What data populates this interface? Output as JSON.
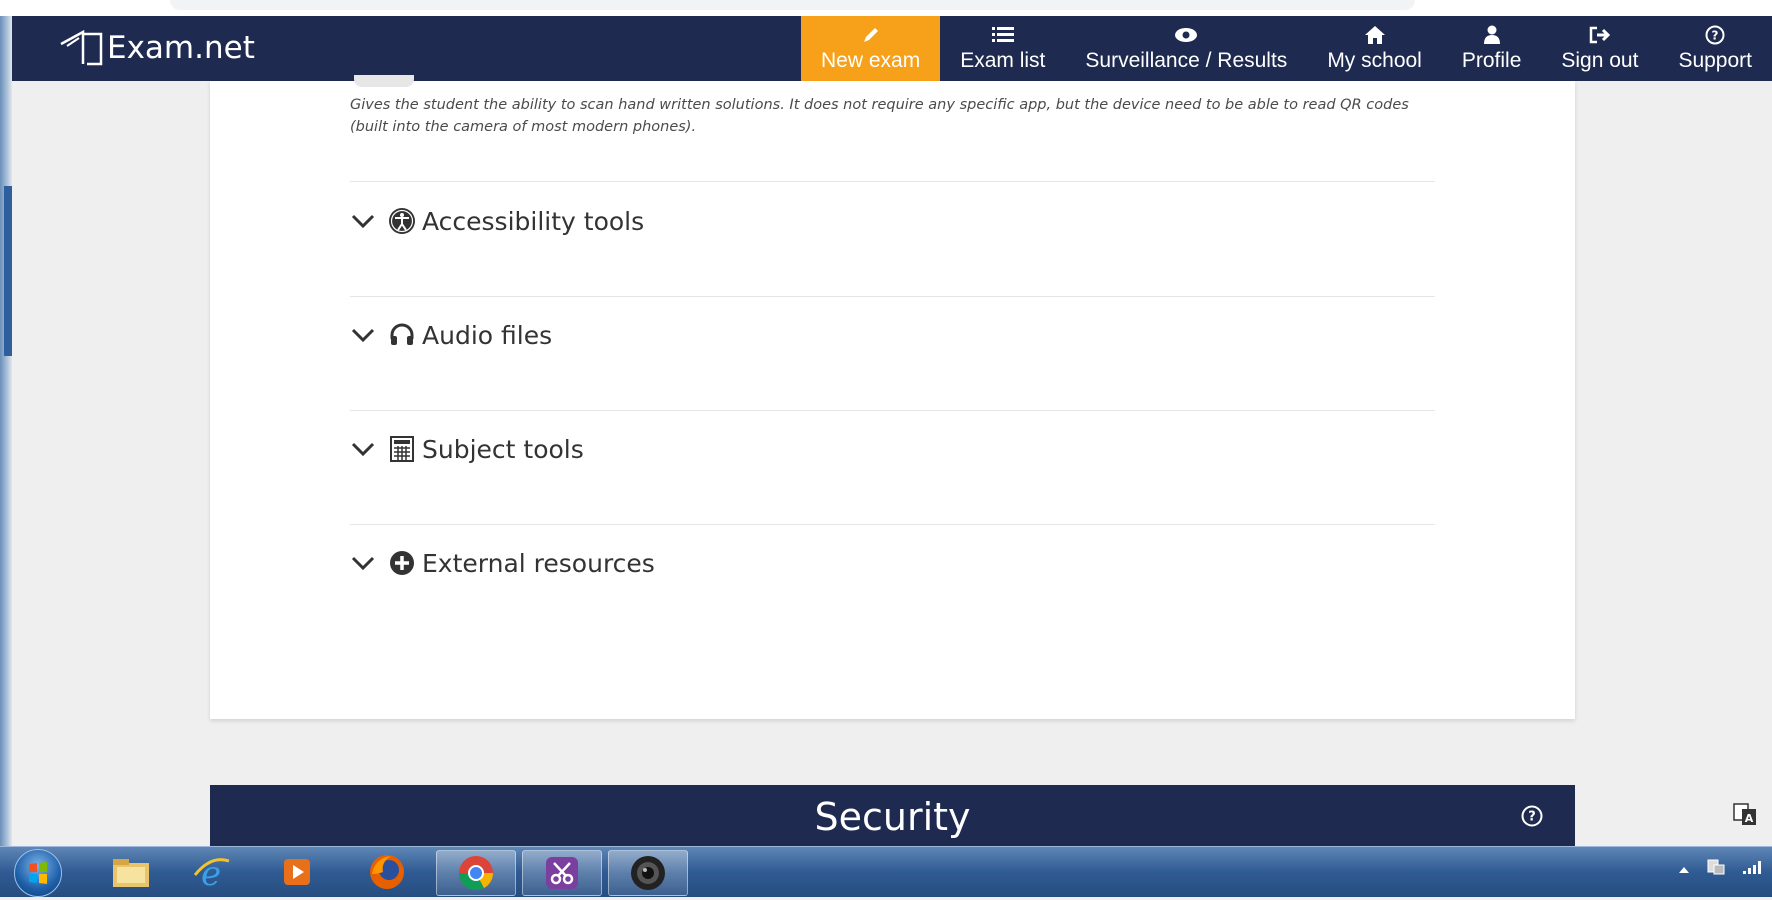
{
  "app": {
    "logo_text": "Exam.net"
  },
  "nav": {
    "items": [
      {
        "label": "New exam",
        "icon": "pencil-icon",
        "active": true
      },
      {
        "label": "Exam list",
        "icon": "list-icon",
        "active": false
      },
      {
        "label": "Surveillance / Results",
        "icon": "eye-icon",
        "active": false
      },
      {
        "label": "My school",
        "icon": "home-icon",
        "active": false
      },
      {
        "label": "Profile",
        "icon": "user-icon",
        "active": false
      },
      {
        "label": "Sign out",
        "icon": "sign-out-icon",
        "active": false
      },
      {
        "label": "Support",
        "icon": "question-circle-icon",
        "active": false
      }
    ]
  },
  "content": {
    "description": "Gives the student the ability to scan hand written solutions. It does not require any specific app, but the device need to be able to read QR codes (built into the camera of most modern phones).",
    "sections": [
      {
        "label": "Accessibility tools",
        "icon": "accessibility-icon"
      },
      {
        "label": "Audio files",
        "icon": "headphones-icon"
      },
      {
        "label": "Subject tools",
        "icon": "calculator-icon"
      },
      {
        "label": "External resources",
        "icon": "plus-circle-icon"
      }
    ]
  },
  "security": {
    "title": "Security",
    "help_icon": "question-circle-icon"
  },
  "taskbar": {
    "apps": [
      "start-orb",
      "file-explorer-icon",
      "internet-explorer-icon",
      "media-player-icon",
      "firefox-icon",
      "chrome-icon",
      "snipping-tool-icon",
      "camera-icon"
    ]
  },
  "colors": {
    "header_bg": "#1e2a4f",
    "active_nav": "#f7a11a",
    "card_bg": "#ffffff",
    "page_bg": "#efefef"
  }
}
